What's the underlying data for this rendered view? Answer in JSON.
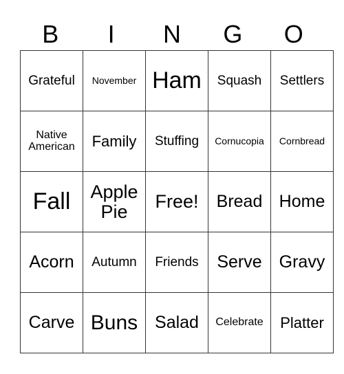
{
  "header": {
    "letters": [
      "B",
      "I",
      "N",
      "G",
      "O"
    ]
  },
  "grid": {
    "rows": [
      [
        "Grateful",
        "November",
        "Ham",
        "Squash",
        "Settlers"
      ],
      [
        "Native American",
        "Family",
        "Stuffing",
        "Cornucopia",
        "Cornbread"
      ],
      [
        "Fall",
        "Apple Pie",
        "Free!",
        "Bread",
        "Home"
      ],
      [
        "Acorn",
        "Autumn",
        "Friends",
        "Serve",
        "Gravy"
      ],
      [
        "Carve",
        "Buns",
        "Salad",
        "Celebrate",
        "Platter"
      ]
    ]
  }
}
